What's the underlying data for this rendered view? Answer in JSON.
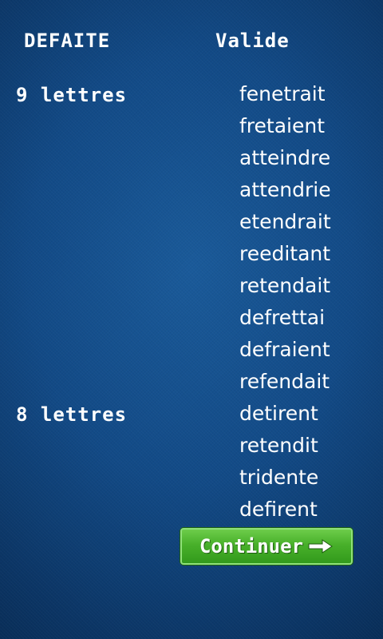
{
  "header": {
    "status": "DEFAITE",
    "valid_title": "Valide"
  },
  "groups": [
    {
      "label": "9 lettres",
      "words": [
        "fenetrait",
        "fretaient",
        "atteindre",
        "attendrie",
        "etendrait",
        "reeditant",
        "retendait",
        "defrettai",
        "defraient",
        "refendait"
      ]
    },
    {
      "label": "8 lettres",
      "words": [
        "detirent",
        "retendit",
        "tridente",
        "defirent"
      ]
    }
  ],
  "continue_button": {
    "label": "Continuer",
    "icon": "arrow-right-icon"
  },
  "colors": {
    "background": "#124a86",
    "button": "#48b02a",
    "text": "#ffffff"
  }
}
